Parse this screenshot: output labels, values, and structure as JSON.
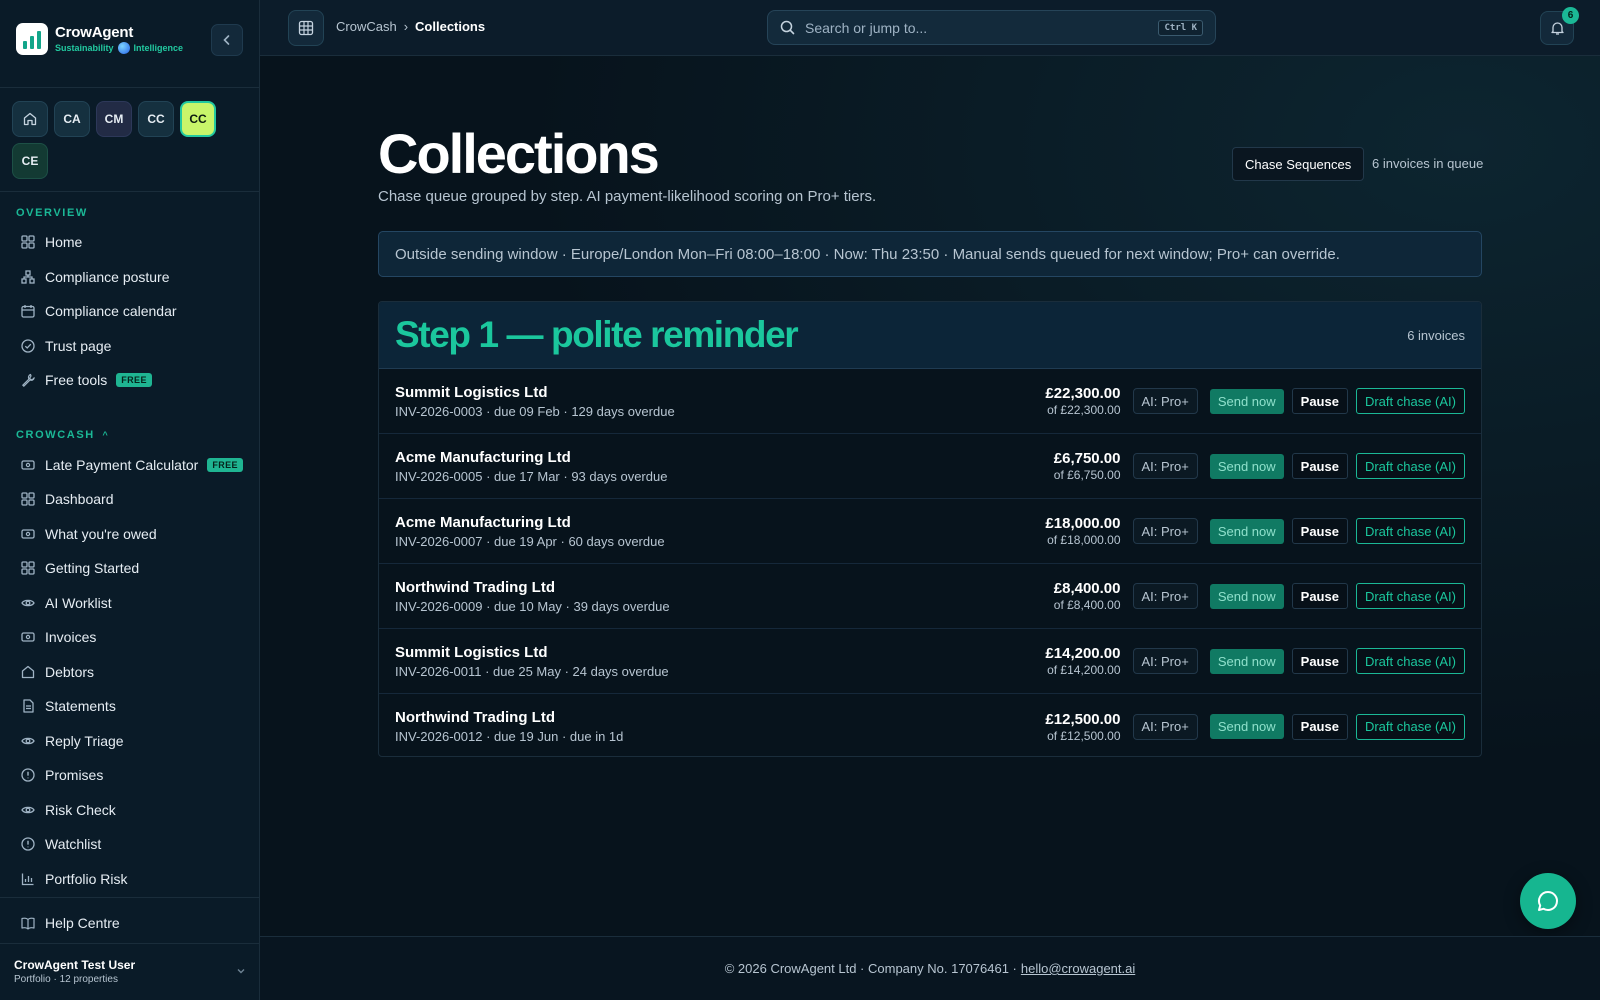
{
  "brand": {
    "name": "CrowAgent",
    "tag_left": "Sustainability",
    "tag_right": "Intelligence"
  },
  "workspaces": [
    "CA",
    "CM",
    "CC",
    "CC",
    "CE"
  ],
  "sidebar": {
    "overview_title": "OVERVIEW",
    "overview_items": [
      {
        "label": "Home",
        "icon": "grid-icon"
      },
      {
        "label": "Compliance posture",
        "icon": "network-icon"
      },
      {
        "label": "Compliance calendar",
        "icon": "calendar-icon"
      },
      {
        "label": "Trust page",
        "icon": "check-circle-icon"
      },
      {
        "label": "Free tools",
        "icon": "wrench-icon",
        "badge": "FREE"
      }
    ],
    "crowcash_title": "CROWCASH",
    "crowcash_items": [
      {
        "label": "Late Payment Calculator",
        "icon": "cash-icon",
        "badge": "FREE"
      },
      {
        "label": "Dashboard",
        "icon": "grid-icon"
      },
      {
        "label": "What you're owed",
        "icon": "cash-icon"
      },
      {
        "label": "Getting Started",
        "icon": "grid-icon"
      },
      {
        "label": "AI Worklist",
        "icon": "eye-icon"
      },
      {
        "label": "Invoices",
        "icon": "cash-icon"
      },
      {
        "label": "Debtors",
        "icon": "home-icon"
      },
      {
        "label": "Statements",
        "icon": "document-icon"
      },
      {
        "label": "Reply Triage",
        "icon": "eye-icon"
      },
      {
        "label": "Promises",
        "icon": "alert-circle-icon"
      },
      {
        "label": "Risk Check",
        "icon": "eye-icon"
      },
      {
        "label": "Watchlist",
        "icon": "alert-circle-icon"
      },
      {
        "label": "Portfolio Risk",
        "icon": "bar-chart-icon"
      }
    ],
    "help_label": "Help Centre",
    "user_name": "CrowAgent Test User",
    "user_sub": "Portfolio · 12 properties"
  },
  "topbar": {
    "crumb_parent": "CrowCash",
    "crumb_sep": "›",
    "crumb_current": "Collections",
    "search_placeholder": "Search or jump to...",
    "search_kbd": "Ctrl K",
    "notifications": "6"
  },
  "page": {
    "title": "Collections",
    "subtitle": "Chase queue grouped by step. AI payment-likelihood scoring on Pro+ tiers.",
    "chase_button": "Chase Sequences",
    "queue_count": "6 invoices in queue",
    "banner": "Outside sending window · Europe/London Mon–Fri 08:00–18:00 · Now: Thu 23:50 · Manual sends queued for next window; Pro+ can override."
  },
  "step": {
    "title": "Step 1 — polite reminder",
    "count": "6 invoices",
    "labels": {
      "ai": "AI: Pro+",
      "send": "Send now",
      "pause": "Pause",
      "draft": "Draft chase (AI)"
    },
    "invoices": [
      {
        "name": "Summit Logistics Ltd",
        "meta": "INV-2026-0003 · due 09 Feb · 129 days overdue",
        "amount": "£22,300.00",
        "of": "of £22,300.00"
      },
      {
        "name": "Acme Manufacturing Ltd",
        "meta": "INV-2026-0005 · due 17 Mar · 93 days overdue",
        "amount": "£6,750.00",
        "of": "of £6,750.00"
      },
      {
        "name": "Acme Manufacturing Ltd",
        "meta": "INV-2026-0007 · due 19 Apr · 60 days overdue",
        "amount": "£18,000.00",
        "of": "of £18,000.00"
      },
      {
        "name": "Northwind Trading Ltd",
        "meta": "INV-2026-0009 · due 10 May · 39 days overdue",
        "amount": "£8,400.00",
        "of": "of £8,400.00"
      },
      {
        "name": "Summit Logistics Ltd",
        "meta": "INV-2026-0011 · due 25 May · 24 days overdue",
        "amount": "£14,200.00",
        "of": "of £14,200.00"
      },
      {
        "name": "Northwind Trading Ltd",
        "meta": "INV-2026-0012 · due 19 Jun · due in 1d",
        "amount": "£12,500.00",
        "of": "of £12,500.00"
      }
    ]
  },
  "footer": {
    "text": "© 2026 CrowAgent Ltd · Company No. 17076461 ·",
    "email": "hello@crowagent.ai"
  },
  "colors": {
    "accent": "#1bc79d",
    "active_workspace": "#c8f56a",
    "background": "#07131c"
  }
}
